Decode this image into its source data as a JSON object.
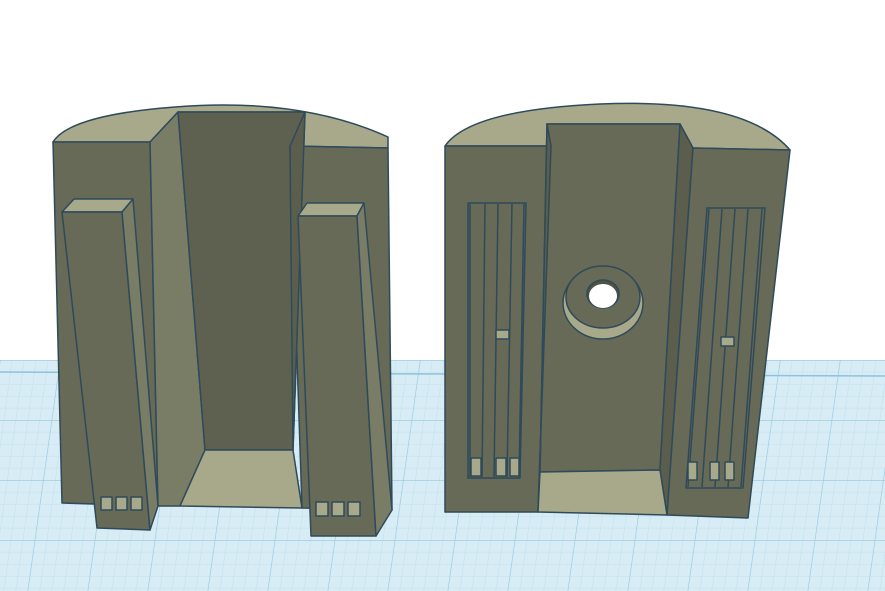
{
  "scene": {
    "description_visible_text": "",
    "colors": {
      "background": "#ffffff",
      "grid_base": "#d7ecf5",
      "grid_line_minor": "#b9dcea",
      "grid_line_major": "#8cc3da",
      "body_front": "#676a56",
      "body_dark": "#5b5e4c",
      "body_side": "#7a7d66",
      "top_face": "#a8a98a",
      "edge": "#2f4a5a"
    },
    "objects": [
      {
        "name": "part-left",
        "kind": "3d-model-part"
      },
      {
        "name": "part-right",
        "kind": "3d-model-part"
      }
    ]
  }
}
